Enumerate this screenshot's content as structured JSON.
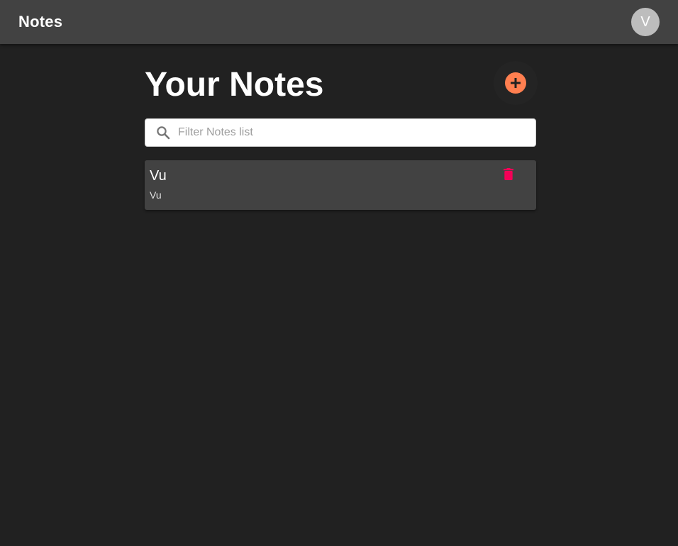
{
  "app_bar": {
    "title": "Notes",
    "avatar_initial": "V"
  },
  "main": {
    "title": "Your Notes",
    "add_icon": "plus-circle-icon"
  },
  "search": {
    "placeholder": "Filter Notes list",
    "value": "",
    "icon": "search-icon"
  },
  "notes": [
    {
      "title": "Vu",
      "body": "Vu",
      "delete_icon": "trash-icon"
    }
  ],
  "colors": {
    "background": "#212121",
    "app_bar": "#424242",
    "card": "#424242",
    "accent": "#ff7f50",
    "delete": "#f50057",
    "avatar": "#bdbdbd"
  }
}
